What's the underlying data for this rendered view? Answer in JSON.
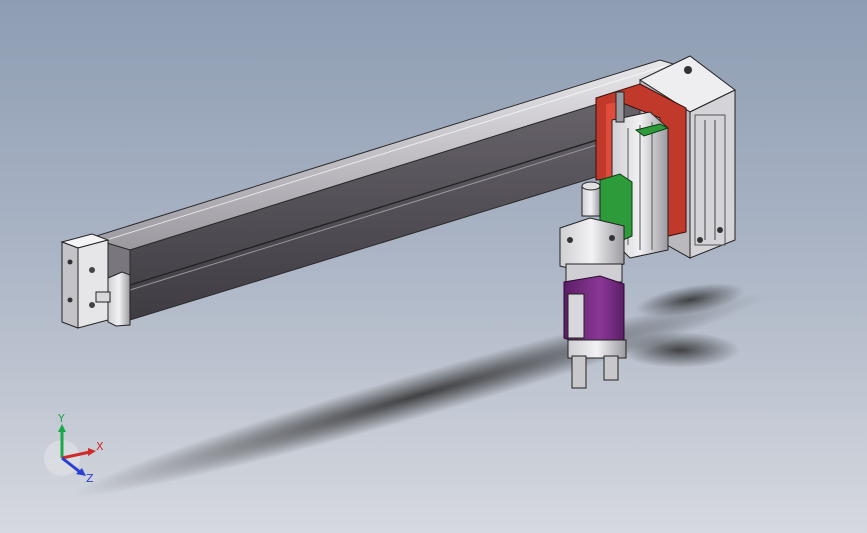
{
  "viewport": {
    "background_top": "#8e9db3",
    "background_bottom": "#d6d9df"
  },
  "model": {
    "beam_color": "#5a555c",
    "beam_highlight": "#c9c7cc",
    "bracket_color": "#c0392b",
    "green_plate_color": "#2e9b3a",
    "gripper_body_color": "#7b2d86",
    "metal_color": "#b8b8bc"
  },
  "triad": {
    "x_label": "X",
    "y_label": "Y",
    "z_label": "Z",
    "x_color": "#d12a2a",
    "y_color": "#1aa84a",
    "z_color": "#2a3fd1"
  }
}
